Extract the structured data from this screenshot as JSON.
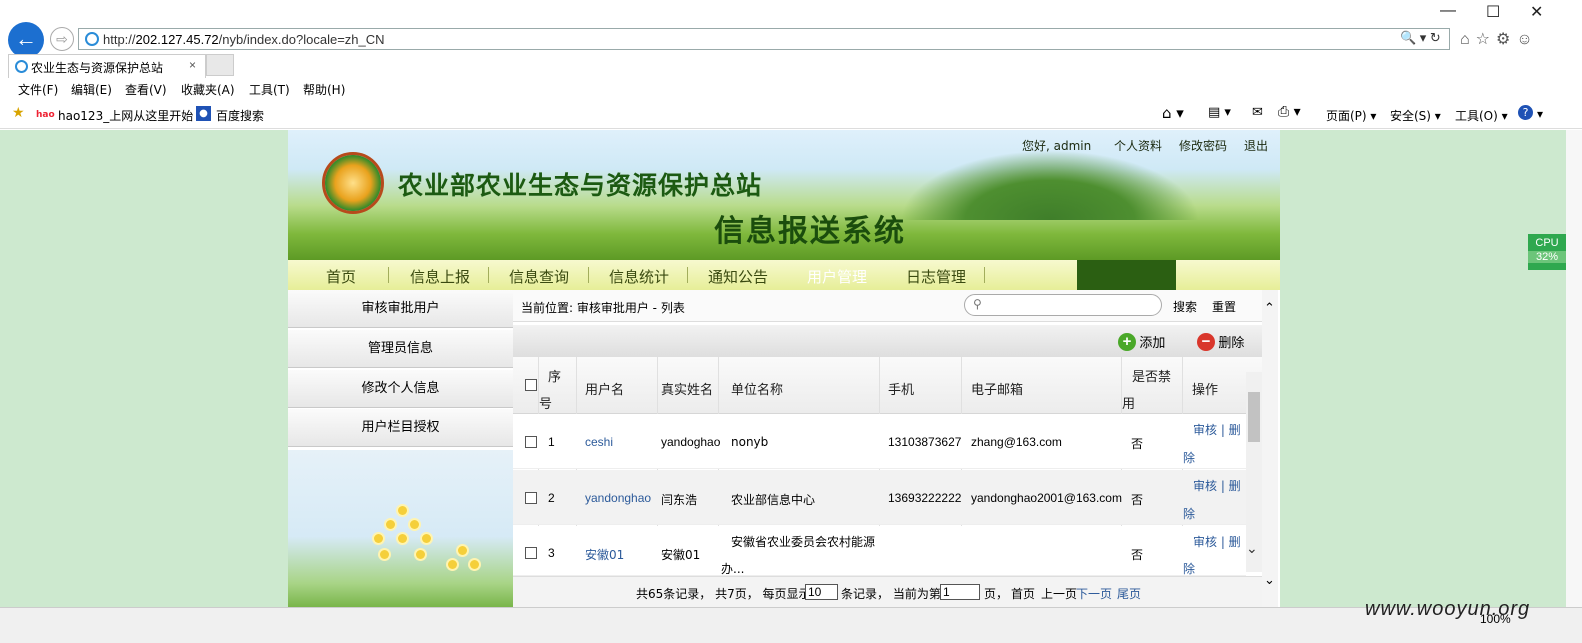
{
  "browser": {
    "url_prefix": "http://",
    "url_host": "202.127.45.72",
    "url_path": "/nyb/index.do?locale=zh_CN",
    "tab_title": "农业生态与资源保护总站",
    "tab_close": "×",
    "menu": [
      "文件(F)",
      "编辑(E)",
      "查看(V)",
      "收藏夹(A)",
      "工具(T)",
      "帮助(H)"
    ],
    "favorites": [
      "hao123_上网从这里开始",
      "百度搜索"
    ],
    "command_bar": [
      "页面(P) ▾",
      "安全(S) ▾",
      "工具(O) ▾"
    ],
    "zoom": "100%",
    "window_controls": [
      "—",
      "☐",
      "✕"
    ]
  },
  "site": {
    "org_name": "农业部农业生态与资源保护总站",
    "system_name": "信息报送系统",
    "greeting": "您好, admin",
    "links": [
      "个人资料",
      "修改密码",
      "退出"
    ],
    "nav": [
      "首页",
      "信息上报",
      "信息查询",
      "信息统计",
      "通知公告",
      "用户管理",
      "日志管理"
    ],
    "nav_active": "用户管理"
  },
  "sidebar": {
    "items": [
      "审核审批用户",
      "管理员信息",
      "修改个人信息",
      "用户栏目授权"
    ]
  },
  "main": {
    "breadcrumb": "当前位置: 审核审批用户 - 列表",
    "search_placeholder": "",
    "search_btn": "搜索",
    "reset_btn": "重置",
    "add_btn": "添加",
    "delete_btn": "删除",
    "columns": {
      "seq_top": "序",
      "seq_bottom": "号",
      "username": "用户名",
      "realname": "真实姓名",
      "unit": "单位名称",
      "phone": "手机",
      "email": "电子邮箱",
      "disabled_top": "是否禁",
      "disabled_bottom": "用",
      "ops": "操作"
    },
    "rows": [
      {
        "seq": "1",
        "username": "ceshi",
        "realname": "yandoghao",
        "unit": "nonyb",
        "unit2": "",
        "phone": "13103873627",
        "email": "zhang@163.com",
        "disabled": "否",
        "op_a": "审核 | 删",
        "op_b": "除"
      },
      {
        "seq": "2",
        "username": "yandonghao",
        "realname": "闫东浩",
        "unit": "农业部信息中心",
        "unit2": "",
        "phone": "13693222222",
        "email": "yandonghao2001@163.com",
        "disabled": "否",
        "op_a": "审核 | 删",
        "op_b": "除"
      },
      {
        "seq": "3",
        "username": "安徽01",
        "realname": "安徽01",
        "unit": "安徽省农业委员会农村能源",
        "unit2": "办...",
        "phone": "",
        "email": "",
        "disabled": "否",
        "op_a": "审核 | 删",
        "op_b": "除"
      }
    ],
    "pager": {
      "summary": "共65条记录， 共7页， 每页显示",
      "per_page": "10",
      "records": "条记录， 当前为第",
      "current": "1",
      "page": "页，",
      "first": "首页",
      "prev": "上一页",
      "next": "下一页",
      "last": "尾页"
    }
  },
  "overlay": {
    "cpu_label": "CPU",
    "cpu_value": "32%",
    "watermark": "www.wooyun.org"
  },
  "colors": {
    "nav_active": "#2b5f12",
    "link": "#2c5a9a",
    "page_bg": "#cde9cf"
  }
}
